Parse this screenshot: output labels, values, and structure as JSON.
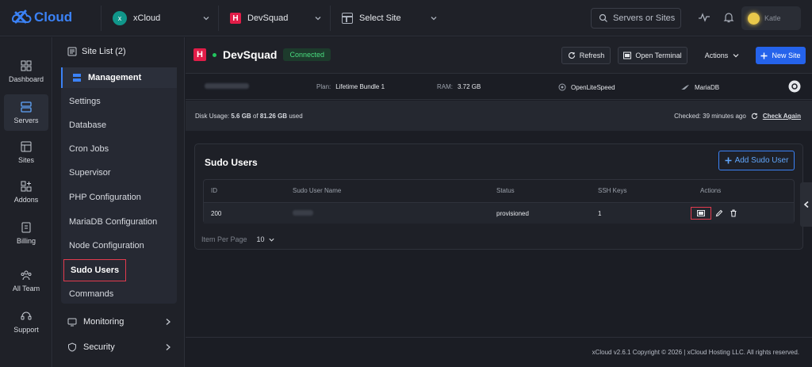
{
  "app": {
    "brand": "Cloud"
  },
  "topbar": {
    "server_initial": "x",
    "server_name": "xCloud",
    "site_name": "DevSquad",
    "select_site": "Select Site",
    "search_placeholder": "Servers or Sites",
    "user_name": "Katle"
  },
  "left_nav": [
    {
      "label": "Dashboard",
      "icon": "dashboard-icon"
    },
    {
      "label": "Servers",
      "icon": "servers-icon"
    },
    {
      "label": "Sites",
      "icon": "sites-icon"
    },
    {
      "label": "Addons",
      "icon": "addons-icon"
    },
    {
      "label": "Billing",
      "icon": "billing-icon"
    },
    {
      "label": "All Team",
      "icon": "team-icon"
    },
    {
      "label": "Support",
      "icon": "support-icon"
    }
  ],
  "sidebar": {
    "site_list": "Site List (2)",
    "management": "Management",
    "items": [
      "Settings",
      "Database",
      "Cron Jobs",
      "Supervisor",
      "PHP Configuration",
      "MariaDB Configuration",
      "Node Configuration",
      "Sudo Users",
      "Commands"
    ],
    "monitoring": "Monitoring",
    "security": "Security"
  },
  "header": {
    "badge": "H",
    "title": "DevSquad",
    "status": "Connected",
    "refresh": "Refresh",
    "terminal": "Open Terminal",
    "actions": "Actions",
    "new_site": "New Site"
  },
  "info": {
    "plan_label": "Plan:",
    "plan": "Lifetime Bundle 1",
    "ram_label": "RAM:",
    "ram": "3.72 GB",
    "web_server": "OpenLiteSpeed",
    "database": "MariaDB"
  },
  "disk": {
    "label": "Disk Usage:",
    "used": "5.6 GB",
    "of": "of",
    "total": "81.26 GB",
    "suffix": "used",
    "checked": "Checked: 39 minutes ago",
    "check_again": "Check Again"
  },
  "sudo": {
    "title": "Sudo Users",
    "add_button": "Add Sudo User",
    "columns": [
      "ID",
      "Sudo User Name",
      "Status",
      "SSH Keys",
      "Actions"
    ],
    "rows": [
      {
        "id": "200",
        "status": "provisioned",
        "ssh_keys": "1"
      }
    ],
    "per_page_label": "Item Per Page",
    "per_page": "10"
  },
  "footer": {
    "text": "xCloud v2.6.1 Copyright © 2026 | xCloud Hosting LLC. All rights reserved."
  },
  "colors": {
    "accent": "#3b82f6",
    "connected": "#4ade80",
    "highlight": "#e23b4e",
    "site_badge": "#e11d48"
  }
}
